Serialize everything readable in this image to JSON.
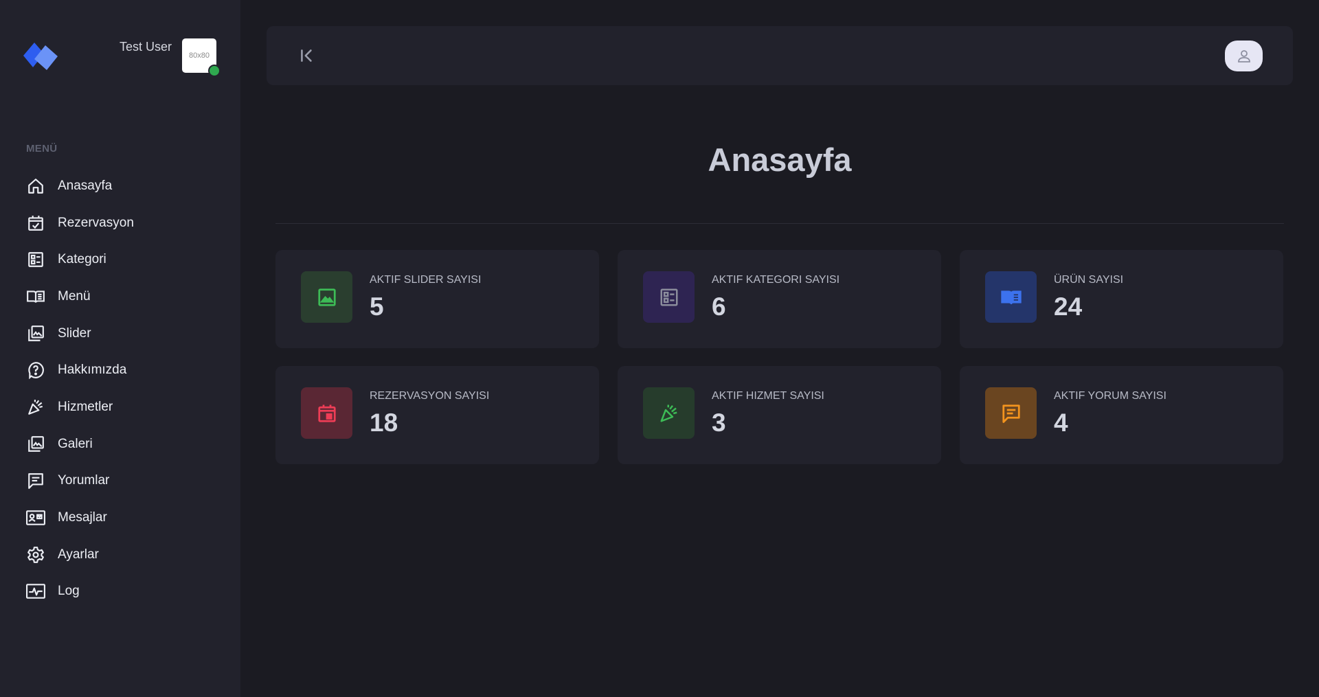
{
  "user": {
    "name": "Test User",
    "avatar_placeholder": "80x80"
  },
  "sidebar": {
    "menu_caption": "MENÜ",
    "items": [
      {
        "label": "Anasayfa",
        "icon": "home-icon"
      },
      {
        "label": "Rezervasyon",
        "icon": "calendar-check-icon"
      },
      {
        "label": "Kategori",
        "icon": "category-list-icon"
      },
      {
        "label": "Menü",
        "icon": "open-book-icon"
      },
      {
        "label": "Slider",
        "icon": "image-gallery-icon"
      },
      {
        "label": "Hakkımızda",
        "icon": "question-bubble-icon"
      },
      {
        "label": "Hizmetler",
        "icon": "party-popper-icon"
      },
      {
        "label": "Galeri",
        "icon": "image-gallery-icon"
      },
      {
        "label": "Yorumlar",
        "icon": "comment-icon"
      },
      {
        "label": "Mesajlar",
        "icon": "contact-card-icon"
      },
      {
        "label": "Ayarlar",
        "icon": "gear-icon"
      },
      {
        "label": "Log",
        "icon": "activity-log-icon"
      }
    ]
  },
  "page": {
    "title": "Anasayfa"
  },
  "stats": [
    {
      "label": "AKTIF SLIDER SAYISI",
      "value": "5",
      "icon": "image-icon",
      "bg": "#2a3e2f",
      "fg": "#3dbb56"
    },
    {
      "label": "AKTIF KATEGORI SAYISI",
      "value": "6",
      "icon": "category-list-icon",
      "bg": "#2e2452",
      "fg": "#8b8d9c"
    },
    {
      "label": "ÜRÜN SAYISI",
      "value": "24",
      "icon": "open-book-icon",
      "bg": "#24356a",
      "fg": "#3c72ee"
    },
    {
      "label": "REZERVASYON SAYISI",
      "value": "18",
      "icon": "calendar-event-icon",
      "bg": "#5a2734",
      "fg": "#ee3d56"
    },
    {
      "label": "AKTIF HIZMET SAYISI",
      "value": "3",
      "icon": "party-popper-icon",
      "bg": "#263c2c",
      "fg": "#3dbb56"
    },
    {
      "label": "AKTIF YORUM SAYISI",
      "value": "4",
      "icon": "comment-icon",
      "bg": "#6a4520",
      "fg": "#f3941e"
    }
  ]
}
